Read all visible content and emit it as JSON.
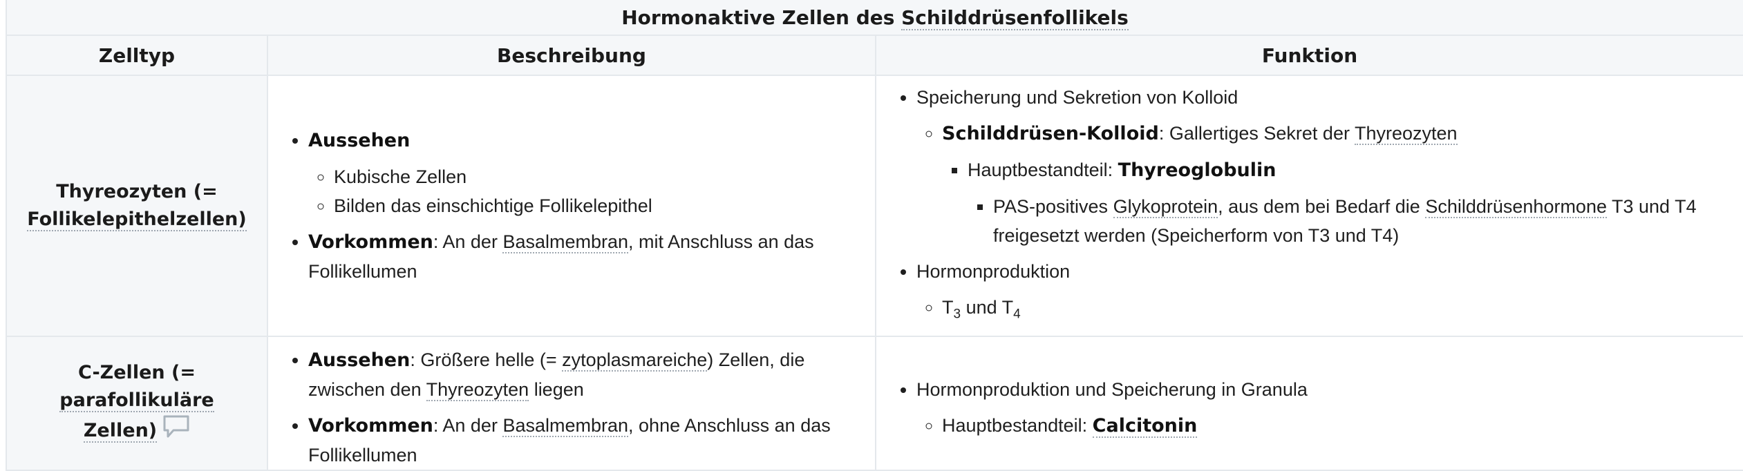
{
  "table": {
    "caption_prefix": "Hormonaktive Zellen des ",
    "caption_link": "Schilddrüsenfollikels",
    "headers": {
      "celltype": "Zelltyp",
      "description": "Beschreibung",
      "function": "Funktion"
    }
  },
  "rows": [
    {
      "celltype_line1": "Thyreozyten (=",
      "celltype_link": "Follikelepithelzellen)",
      "desc": {
        "aussehen_label": "Aussehen",
        "aussehen_items": [
          "Kubische Zellen",
          "Bilden das einschichtige Follikelepithel"
        ],
        "vorkommen_label": "Vorkommen",
        "vorkommen_pre": ": An der ",
        "vorkommen_link": "Basalmembran",
        "vorkommen_post": ", mit Anschluss an das Follikellumen"
      },
      "func": {
        "item1": "Speicherung und Sekretion von Kolloid",
        "kolloid_label": "Schilddrüsen-Kolloid",
        "kolloid_pre": ": Gallertiges Sekret der ",
        "kolloid_link": "Thyreozyten",
        "haupt_pre": "Hauptbestandteil: ",
        "haupt_bold": "Thyreoglobulin",
        "pas_pre": "PAS-positives ",
        "pas_link1": "Glykoprotein",
        "pas_mid": ", aus dem bei Bedarf die ",
        "pas_link2": "Schilddrüsenhormone",
        "pas_post": " T3 und T4 freigesetzt werden (Speicherform von T3 und T4)",
        "item2": "Hormonproduktion",
        "t_text": "T",
        "t3_sub": "3",
        "und_text": " und T",
        "t4_sub": "4"
      }
    },
    {
      "celltype_line1": "C-Zellen (= ",
      "celltype_link1": "parafollikuläre",
      "celltype_link2": "Zellen)",
      "desc": {
        "aussehen_label": "Aussehen",
        "aussehen_pre": ": Größere helle (= ",
        "aussehen_link": "zytoplasmareiche",
        "aussehen_mid": ") Zellen, die zwischen den ",
        "aussehen_link2": "Thyreozyten",
        "aussehen_post": " liegen",
        "vorkommen_label": "Vorkommen",
        "vorkommen_pre": ": An der ",
        "vorkommen_link": "Basalmembran",
        "vorkommen_post": ", ohne Anschluss an das Follikellumen"
      },
      "func": {
        "item1": "Hormonproduktion und Speicherung in Granula",
        "haupt_pre": "Hauptbestandteil: ",
        "haupt_link_bold": "Calcitonin"
      }
    }
  ],
  "icons": {
    "comment": "speech-bubble-icon"
  },
  "colors": {
    "header_bg": "#f5f7f9",
    "border": "#e4e8ec",
    "link_underline": "#9fa7b0"
  }
}
